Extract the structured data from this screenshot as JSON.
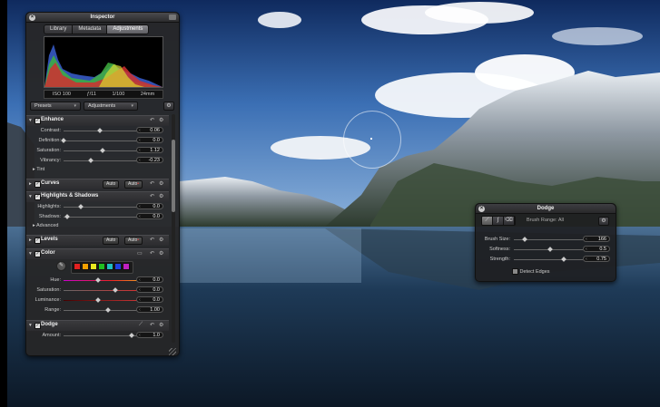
{
  "inspector": {
    "title": "Inspector",
    "tabs": [
      {
        "label": "Library",
        "active": false
      },
      {
        "label": "Metadata",
        "active": false
      },
      {
        "label": "Adjustments",
        "active": true
      }
    ],
    "exif": {
      "iso": "ISO 100",
      "aperture": "ƒ/11",
      "shutter": "1/100",
      "focal": "24mm"
    },
    "presets_label": "Presets",
    "adjustments_label": "Adjustments",
    "enhance": {
      "title": "Enhance",
      "rows": [
        {
          "label": "Contrast:",
          "value": "0.06",
          "pos": 0.53
        },
        {
          "label": "Definition:",
          "value": "0.0",
          "pos": 0.0
        },
        {
          "label": "Saturation:",
          "value": "1.12",
          "pos": 0.56
        },
        {
          "label": "Vibrancy:",
          "value": "-0.23",
          "pos": 0.39
        }
      ],
      "tint_label": "Tint"
    },
    "curves": {
      "title": "Curves",
      "auto_label": "Auto"
    },
    "highlights_shadows": {
      "title": "Highlights & Shadows",
      "rows": [
        {
          "label": "Highlights:",
          "value": "0.0",
          "pos": 0.0
        },
        {
          "label": "Shadows:",
          "value": "0.0",
          "pos": 0.0
        }
      ],
      "advanced_label": "Advanced"
    },
    "levels": {
      "title": "Levels",
      "auto_label": "Auto"
    },
    "color": {
      "title": "Color",
      "swatches": [
        "#e02020",
        "#f0a000",
        "#e8e820",
        "#20c020",
        "#20c0c0",
        "#2040e0",
        "#c020c0"
      ],
      "rows": [
        {
          "label": "Hue:",
          "value": "0.0",
          "pos": 0.5
        },
        {
          "label": "Saturation:",
          "value": "0.0",
          "pos": 0.75
        },
        {
          "label": "Luminance:",
          "value": "0.0",
          "pos": 0.5
        },
        {
          "label": "Range:",
          "value": "1.00",
          "pos": 0.64
        }
      ]
    },
    "dodge": {
      "title": "Dodge",
      "rows": [
        {
          "label": "Amount:",
          "value": "1.0",
          "pos": 0.99
        }
      ]
    }
  },
  "dodge_hud": {
    "title": "Dodge",
    "brush_range": "Brush Range: All",
    "rows": [
      {
        "label": "Brush Size:",
        "value": "166",
        "pos": 0.04
      },
      {
        "label": "Softness:",
        "value": "0.5",
        "pos": 0.5
      },
      {
        "label": "Strength:",
        "value": "0.75",
        "pos": 0.75
      }
    ],
    "detect_edges_label": "Detect Edges"
  },
  "colors": {
    "panel": "#262628",
    "accent_active_tab": "#7a7a80"
  }
}
